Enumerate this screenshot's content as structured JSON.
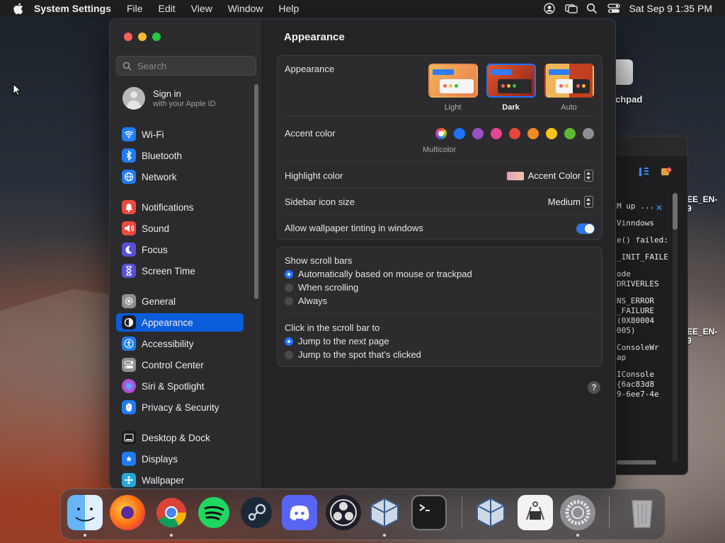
{
  "menubar": {
    "app_name": "System Settings",
    "menus": [
      "File",
      "Edit",
      "View",
      "Window",
      "Help"
    ],
    "clock": "Sat Sep 9  1:35 PM"
  },
  "desktop": {
    "icon_label": "chpad",
    "side_labels": [
      "EE_EN-\n9",
      "EE_EN-\n9"
    ]
  },
  "console_window": {
    "log_lines": [
      "M up ...",
      "Vinndows",
      "",
      "e() failed:",
      "_INIT_FAILE",
      "",
      "ode\nDRIVERLES",
      "",
      "NS_ERROR\n_FAILURE\n(0X80004\n005)",
      "ConsoleWr\nap",
      "IConsole\n{6ac83d8\n9-6ee7-4e"
    ]
  },
  "settings": {
    "search_placeholder": "Search",
    "account": {
      "name": "Sign in",
      "subtitle": "with your Apple ID"
    },
    "sidebar_items": [
      {
        "label": "Wi-Fi",
        "icon": "wifi-icon",
        "color": "#1f7cf6"
      },
      {
        "label": "Bluetooth",
        "icon": "bluetooth-icon",
        "color": "#1f7cf6"
      },
      {
        "label": "Network",
        "icon": "globe-icon",
        "color": "#1f7cf6"
      },
      {
        "label": "Notifications",
        "icon": "bell-icon",
        "color": "#ec4a41"
      },
      {
        "label": "Sound",
        "icon": "speaker-icon",
        "color": "#ec4a41"
      },
      {
        "label": "Focus",
        "icon": "moon-icon",
        "color": "#5a4fd6"
      },
      {
        "label": "Screen Time",
        "icon": "hourglass-icon",
        "color": "#5a4fd6"
      },
      {
        "label": "General",
        "icon": "gear-icon",
        "color": "#8e8e93"
      },
      {
        "label": "Appearance",
        "icon": "appearance-icon",
        "color": "#1c1c1e"
      },
      {
        "label": "Accessibility",
        "icon": "accessibility-icon",
        "color": "#1f7cf6"
      },
      {
        "label": "Control Center",
        "icon": "control-center-icon",
        "color": "#8e8e93"
      },
      {
        "label": "Siri & Spotlight",
        "icon": "siri-icon",
        "color": "#b34ad9"
      },
      {
        "label": "Privacy & Security",
        "icon": "hand-icon",
        "color": "#1f7cf6"
      },
      {
        "label": "Desktop & Dock",
        "icon": "dock-icon",
        "color": "#1c1c1e"
      },
      {
        "label": "Displays",
        "icon": "display-icon",
        "color": "#1f7cf6"
      },
      {
        "label": "Wallpaper",
        "icon": "wallpaper-icon",
        "color": "#2aa7d8"
      }
    ],
    "selected_item": "Appearance",
    "page_title": "Appearance",
    "appearance": {
      "label": "Appearance",
      "options": [
        "Light",
        "Dark",
        "Auto"
      ],
      "selected": "Dark"
    },
    "accent_color": {
      "label": "Accent color",
      "colors": [
        "multicolor",
        "#1f74ff",
        "#9b4fc4",
        "#e6458f",
        "#e8453c",
        "#f08a24",
        "#f7c417",
        "#5fb834",
        "#8e8e93"
      ],
      "selected_caption": "Multicolor"
    },
    "highlight_color": {
      "label": "Highlight color",
      "value": "Accent Color"
    },
    "sidebar_icon_size": {
      "label": "Sidebar icon size",
      "value": "Medium"
    },
    "wallpaper_tinting": {
      "label": "Allow wallpaper tinting in windows",
      "enabled": true
    },
    "show_scroll_bars": {
      "label": "Show scroll bars",
      "options": [
        "Automatically based on mouse or trackpad",
        "When scrolling",
        "Always"
      ],
      "selected": 0
    },
    "click_scroll_bar": {
      "label": "Click in the scroll bar to",
      "options": [
        "Jump to the next page",
        "Jump to the spot that’s clicked"
      ],
      "selected": 0
    },
    "help_label": "?"
  },
  "dock": {
    "apps": [
      "Finder",
      "Firefox",
      "Chrome",
      "Spotify",
      "Steam",
      "Discord",
      "OBS",
      "VirtualBox",
      "Terminal",
      "VirtualBox VM",
      "System Information",
      "System Settings",
      "Trash"
    ]
  }
}
